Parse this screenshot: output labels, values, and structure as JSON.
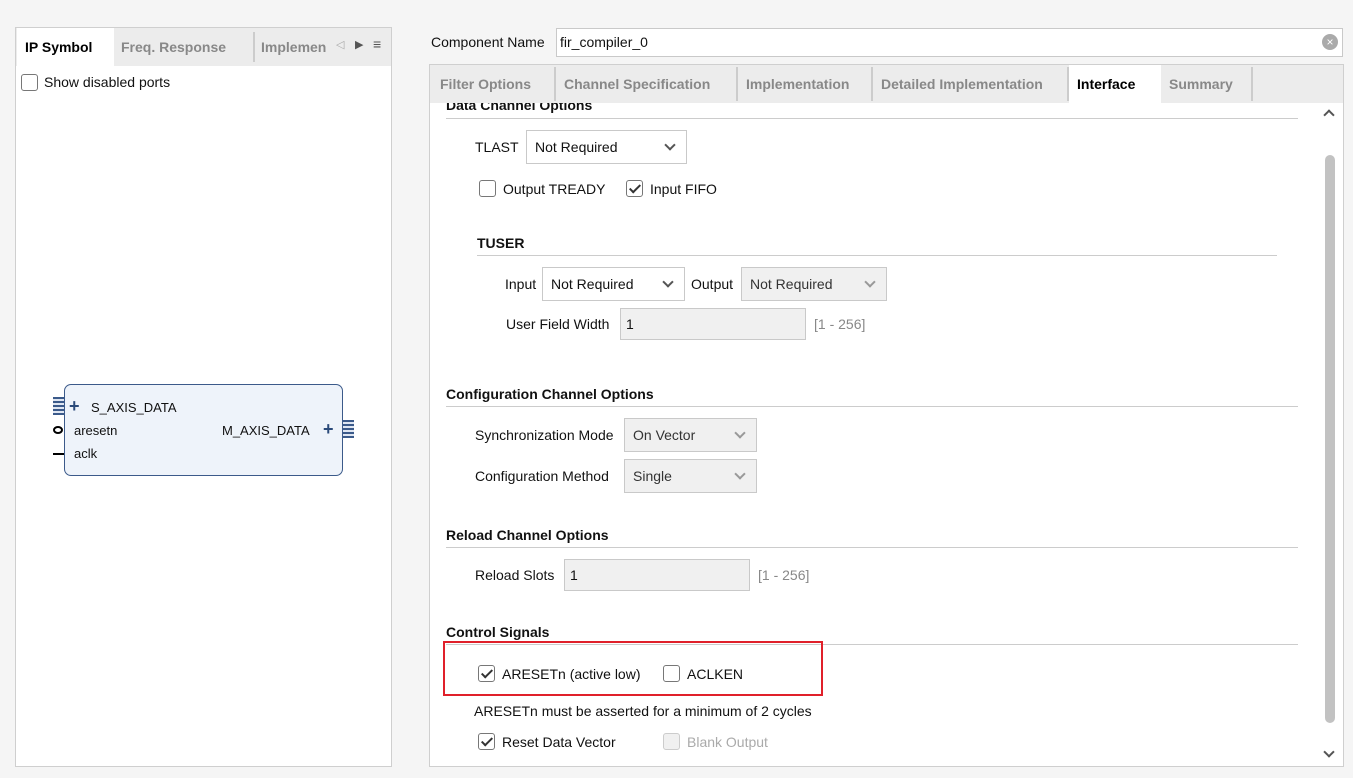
{
  "left_panel": {
    "tabs": [
      {
        "label": "IP Symbol",
        "active": true
      },
      {
        "label": "Freq. Response"
      },
      {
        "label": "Implemen"
      }
    ],
    "show_disabled_ports": {
      "label": "Show disabled ports",
      "checked": false
    },
    "symbol": {
      "ports_left": [
        "S_AXIS_DATA",
        "aresetn",
        "aclk"
      ],
      "ports_right": [
        "M_AXIS_DATA"
      ]
    }
  },
  "component_name": {
    "label": "Component Name",
    "value": "fir_compiler_0"
  },
  "tabs": [
    {
      "label": "Filter Options"
    },
    {
      "label": "Channel Specification"
    },
    {
      "label": "Implementation"
    },
    {
      "label": "Detailed Implementation"
    },
    {
      "label": "Interface",
      "active": true
    },
    {
      "label": "Summary"
    }
  ],
  "data_channel": {
    "title": "Data Channel Options",
    "tlast": {
      "label": "TLAST",
      "value": "Not Required"
    },
    "output_tready": {
      "label": "Output TREADY",
      "checked": false
    },
    "input_fifo": {
      "label": "Input FIFO",
      "checked": true
    },
    "tuser": {
      "title": "TUSER",
      "input_label": "Input",
      "input_value": "Not Required",
      "output_label": "Output",
      "output_value": "Not Required",
      "width_label": "User Field Width",
      "width_value": "1",
      "width_range": "[1 - 256]"
    }
  },
  "config_channel": {
    "title": "Configuration Channel Options",
    "sync_mode": {
      "label": "Synchronization Mode",
      "value": "On Vector"
    },
    "config_method": {
      "label": "Configuration Method",
      "value": "Single"
    }
  },
  "reload_channel": {
    "title": "Reload Channel Options",
    "slots_label": "Reload Slots",
    "slots_value": "1",
    "slots_range": "[1 - 256]"
  },
  "control_signals": {
    "title": "Control Signals",
    "aresetn": {
      "label": "ARESETn (active low)",
      "checked": true
    },
    "aclken": {
      "label": "ACLKEN",
      "checked": false
    },
    "note": "ARESETn must be asserted for a minimum of 2 cycles",
    "reset_data_vector": {
      "label": "Reset Data Vector",
      "checked": true
    },
    "blank_output": {
      "label": "Blank Output",
      "checked": false,
      "disabled": true
    }
  },
  "colors": {
    "highlight": "#e0202a",
    "symbol_border": "#3b5a8a",
    "symbol_fill": "#eef3fa"
  }
}
